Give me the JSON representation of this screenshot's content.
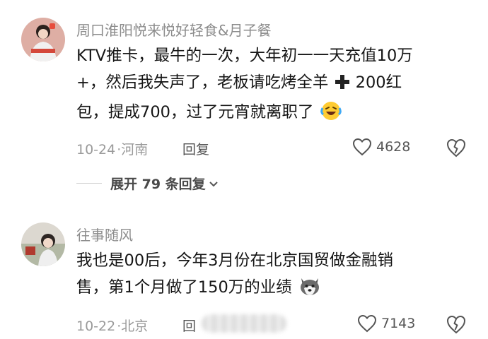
{
  "comments": [
    {
      "author": "周口淮阳悦来悦好轻食&月子餐",
      "lines": [
        "KTV推卡，最牛的一次，大年初一一天充值10万",
        "+，然后我失声了，老板请吃烤全羊",
        " 200红",
        "包，提成700，过了元宵就离职了"
      ],
      "date": "10-24",
      "location": "河南",
      "reply_label": "回复",
      "likes": "4628",
      "expand_label": "展开 79 条回复"
    },
    {
      "author": "往事随风",
      "lines": [
        "我也是00后，今年3月份在北京国贸做金融销",
        "售，第1个月做了150万的业绩"
      ],
      "date": "10-22",
      "location": "北京",
      "reply_label": "回",
      "likes": "7143"
    }
  ],
  "icons": {
    "like": "heart-outline-icon",
    "dislike": "broken-heart-icon",
    "plus": "heavy-plus-icon",
    "emoji1": "laughing-crying-emoji",
    "emoji2": "husky-dog-emoji",
    "chevron": "chevron-down-icon"
  }
}
